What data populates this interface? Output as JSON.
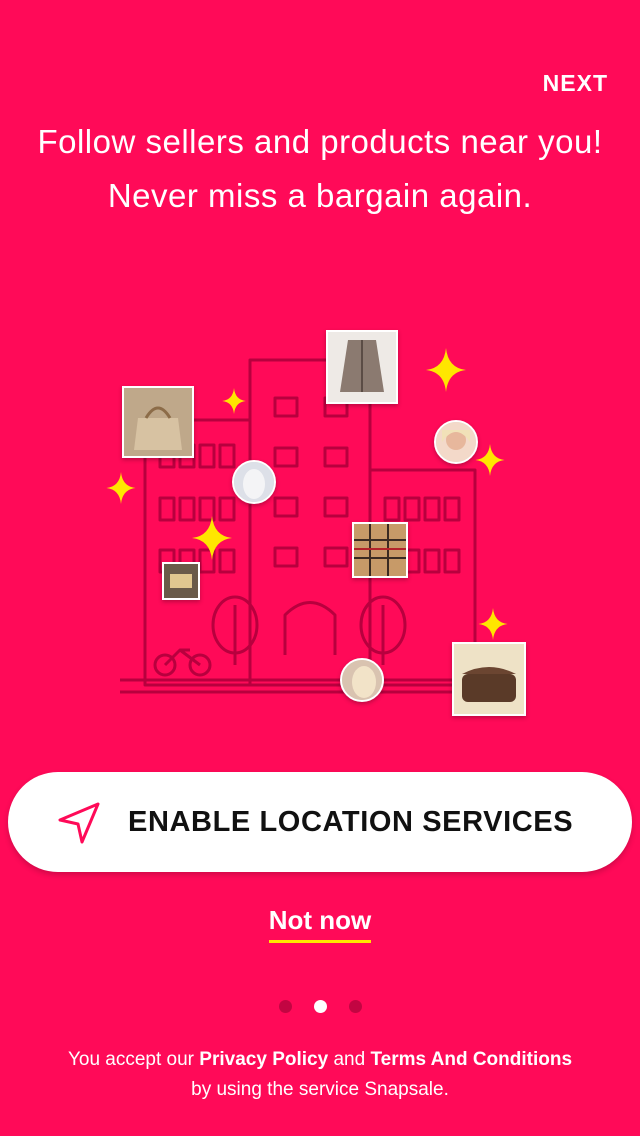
{
  "header": {
    "next_label": "NEXT"
  },
  "headline": "Follow sellers and products near you! Never miss a bargain again.",
  "cta": {
    "label": "ENABLE LOCATION SERVICES",
    "icon": "location-arrow-icon"
  },
  "secondary": {
    "label": "Not now"
  },
  "pager": {
    "count": 3,
    "active_index": 1
  },
  "footer": {
    "prefix": "You accept our ",
    "privacy_link": "Privacy Policy",
    "and": " and ",
    "terms_link": "Terms And Conditions",
    "suffix": "by using the service Snapsale."
  },
  "colors": {
    "background": "#ff0a58",
    "accent": "#ffe600",
    "sparkle": "#ffe600"
  }
}
